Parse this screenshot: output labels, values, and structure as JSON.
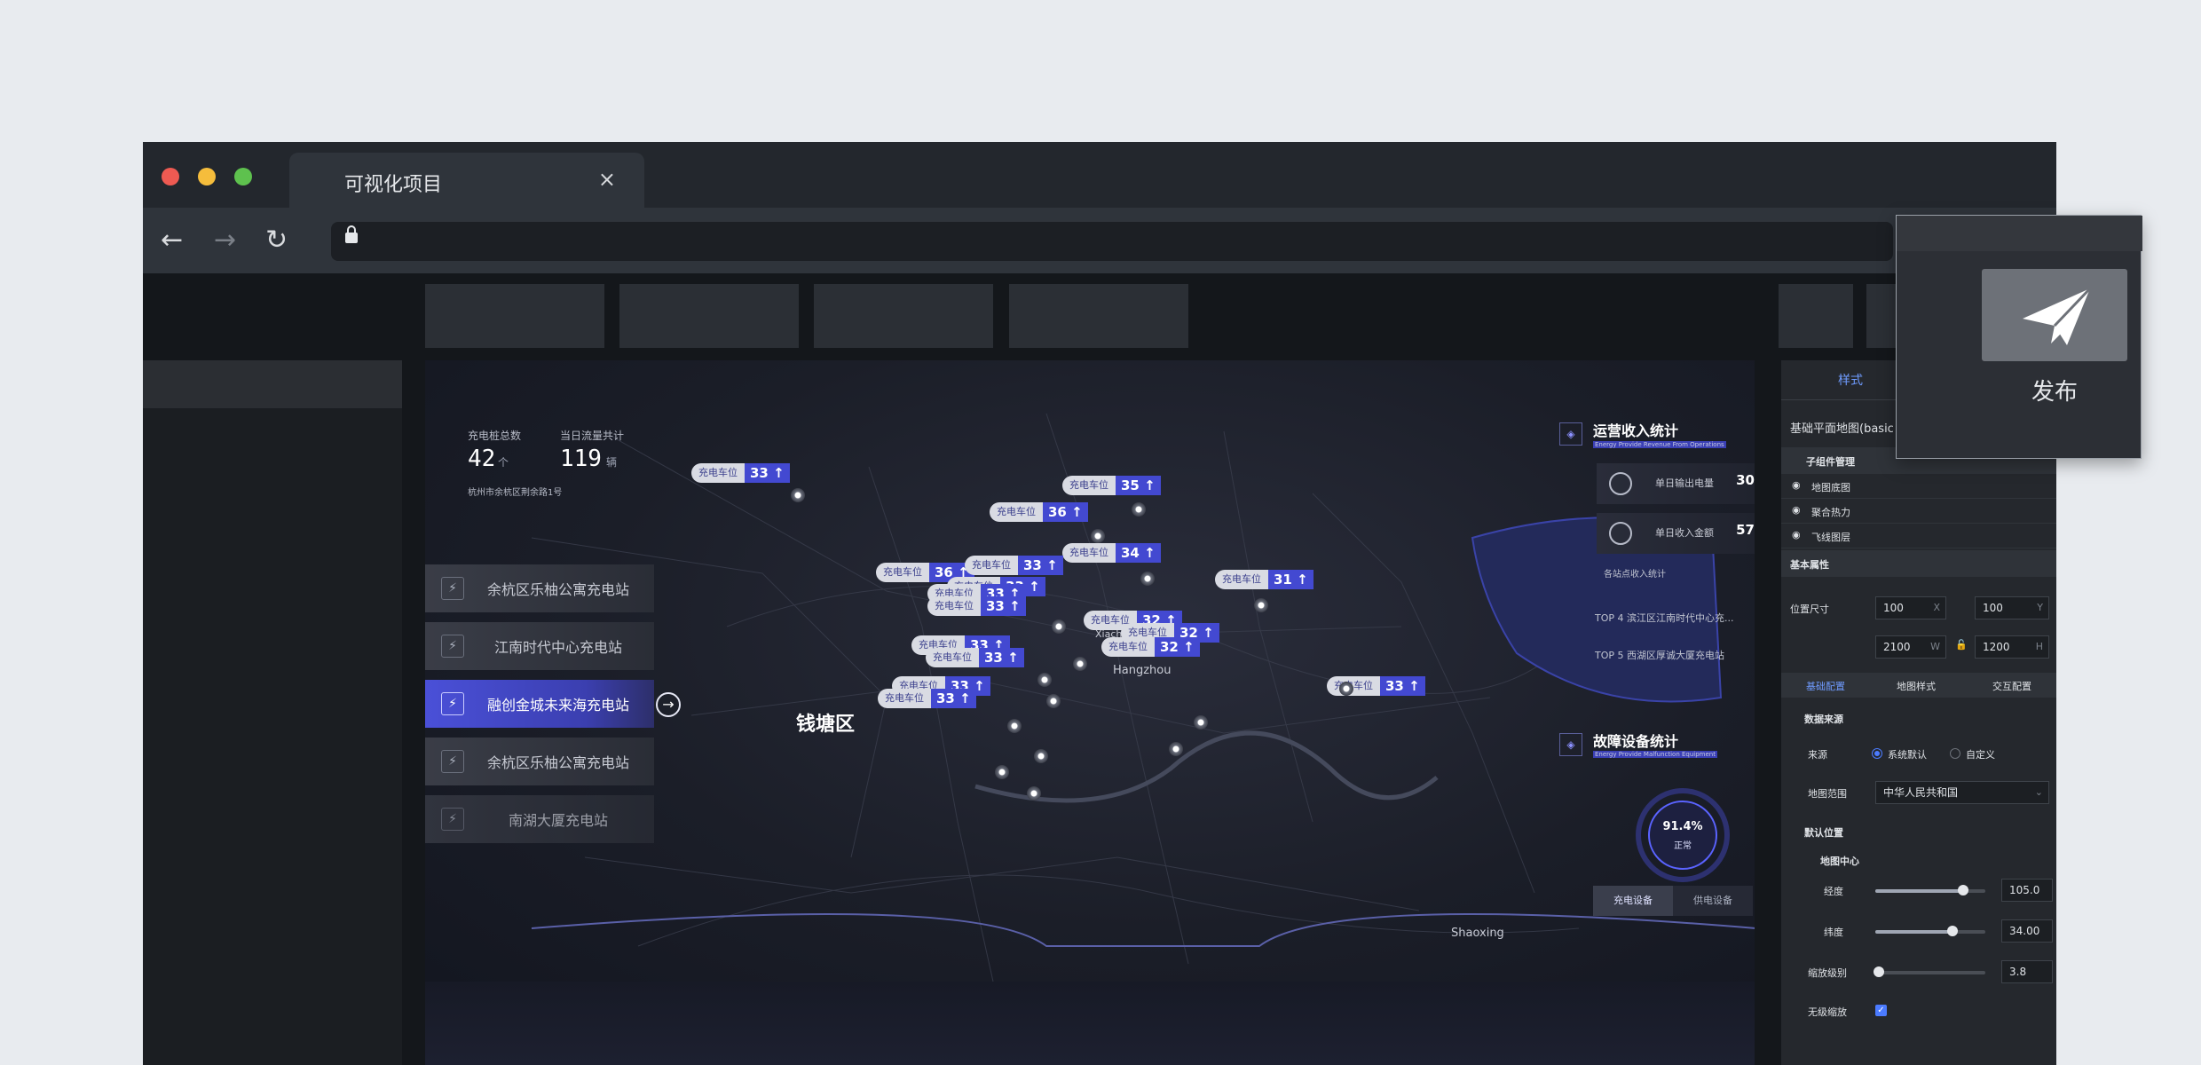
{
  "browser": {
    "tab_title": "可视化项目",
    "tab_close": "×",
    "back": "←",
    "forward": "→",
    "reload": "↻"
  },
  "dashboard": {
    "stat_total_label": "充电桩总数",
    "stat_total_value": "42",
    "stat_total_unit": "个",
    "stat_flow_label": "当日流量共计",
    "stat_flow_value": "119",
    "stat_flow_unit": "辆",
    "address": "杭州市余杭区荆余路1号",
    "stations": [
      {
        "label": "余杭区乐柚公寓充电站"
      },
      {
        "label": "江南时代中心充电站"
      },
      {
        "label": "融创金城未来海充电站"
      },
      {
        "label": "余杭区乐柚公寓充电站"
      },
      {
        "label": "南湖大厦充电站"
      }
    ],
    "marker_label": "充电车位",
    "markers": [
      "33",
      "35",
      "36",
      "34",
      "36",
      "33",
      "33",
      "33",
      "33",
      "31",
      "32",
      "32",
      "32",
      "33",
      "33",
      "33",
      "33",
      "33"
    ],
    "places": {
      "qiantang": "钱塘区",
      "hangzhou": "Hangzhou",
      "xiacheng": "Xiacheng",
      "shaoxing": "Shaoxing"
    },
    "revenue": {
      "title": "运营收入统计",
      "tag": "Energy Provide  Revenue From Operations",
      "kpi1_label": "单日输出电量",
      "kpi1_value": "30",
      "kpi2_label": "单日收入金额",
      "kpi2_value": "57",
      "rank_title": "各站点收入统计",
      "rank4": "TOP 4  滨江区江南时代中心充...",
      "rank5": "TOP 5  西湖区厚诚大厦充电站"
    },
    "fault": {
      "title": "故障设备统计",
      "tag": "Energy Provide  Malfunction Equipment",
      "gauge_value": "91.4%",
      "gauge_label": "正常",
      "tab1": "充电设备",
      "tab2": "供电设备"
    }
  },
  "panel": {
    "tab_style": "样式",
    "component_name": "基础平面地图(basic",
    "sub_mgmt": "子组件管理",
    "layers": [
      "地图底图",
      "聚合热力",
      "飞线图层"
    ],
    "basic_props": "基本属性",
    "pos_size": "位置尺寸",
    "x": "100",
    "x_suf": "X",
    "y": "100",
    "y_suf": "Y",
    "w": "2100",
    "w_suf": "W",
    "h": "1200",
    "h_suf": "H",
    "tabs": [
      "基础配置",
      "地图样式",
      "交互配置"
    ],
    "data_source": "数据来源",
    "source_label": "来源",
    "source_opt1": "系统默认",
    "source_opt2": "自定义",
    "range_label": "地图范围",
    "range_value": "中华人民共和国",
    "default_pos": "默认位置",
    "map_center": "地图中心",
    "lng_label": "经度",
    "lng_value": "105.0",
    "lng_fraction": 0.8,
    "lat_label": "纬度",
    "lat_value": "34.00",
    "lat_fraction": 0.7,
    "zoom_label": "缩放级别",
    "zoom_value": "3.8",
    "zoom_fraction": 0.03,
    "free_zoom": "无级缩放"
  },
  "publish": {
    "label": "发布"
  },
  "colors": {
    "accent": "#4349d1",
    "highlight": "#4b7bff"
  }
}
